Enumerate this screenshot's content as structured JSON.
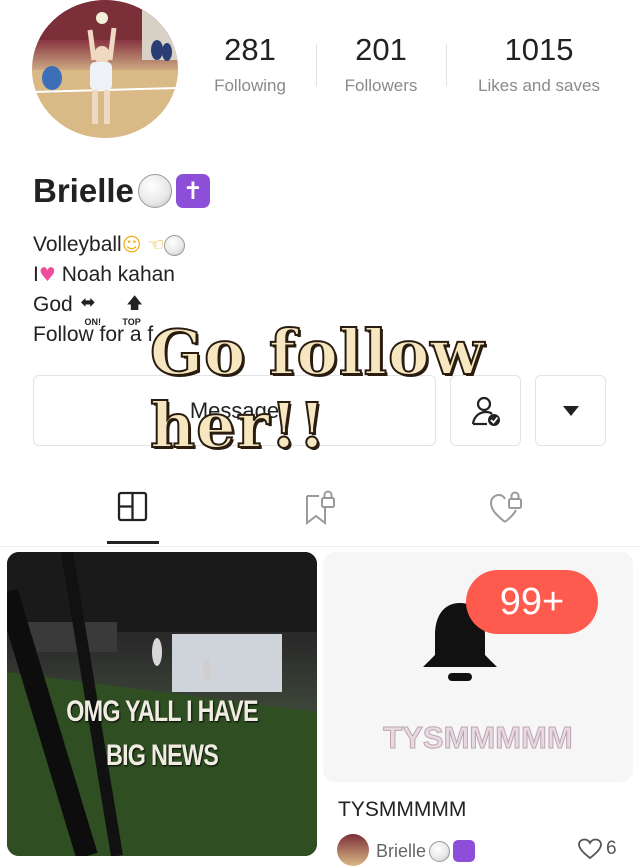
{
  "profile": {
    "name": "Brielle",
    "stats": [
      {
        "value": "281",
        "label": "Following"
      },
      {
        "value": "201",
        "label": "Followers"
      },
      {
        "value": "1015",
        "label": "Likes and saves"
      }
    ],
    "bio": {
      "line1": "Volleyball",
      "line2_prefix": "I",
      "line2_text": "Noah kahan",
      "line3": "God",
      "line3_on": "ON!",
      "line3_top": "TOP",
      "line4": "Follow for a f"
    }
  },
  "overlay_text": "Go follow her!!",
  "actions": {
    "message_label": "Message"
  },
  "posts": [
    {
      "overlay": "OMG YALL I HAVE BIG NEWS"
    },
    {
      "badge": "99+",
      "watermark": "TYSMMMMM",
      "title": "TYSMMMMM",
      "author": "Brielle",
      "likes": "6"
    }
  ],
  "colors": {
    "badge_red": "#ff5a4e",
    "cross_purple": "#8d4fd8",
    "overlay_cream": "#f6e7c1"
  },
  "icons": [
    "gallery-grid-icon",
    "bookmark-lock-icon",
    "heart-lock-icon",
    "person-check-icon",
    "caret-down-icon",
    "bell-icon",
    "heart-outline-icon"
  ]
}
